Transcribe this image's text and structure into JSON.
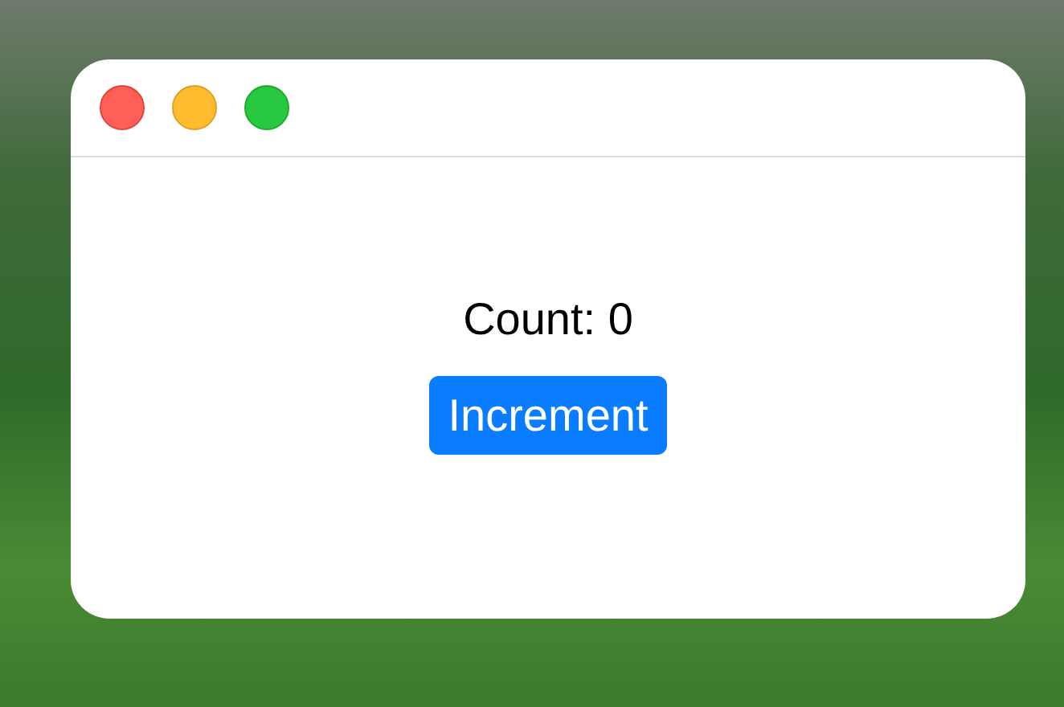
{
  "window": {
    "count_label": "Count: 0"
  },
  "button": {
    "label": "Increment"
  }
}
